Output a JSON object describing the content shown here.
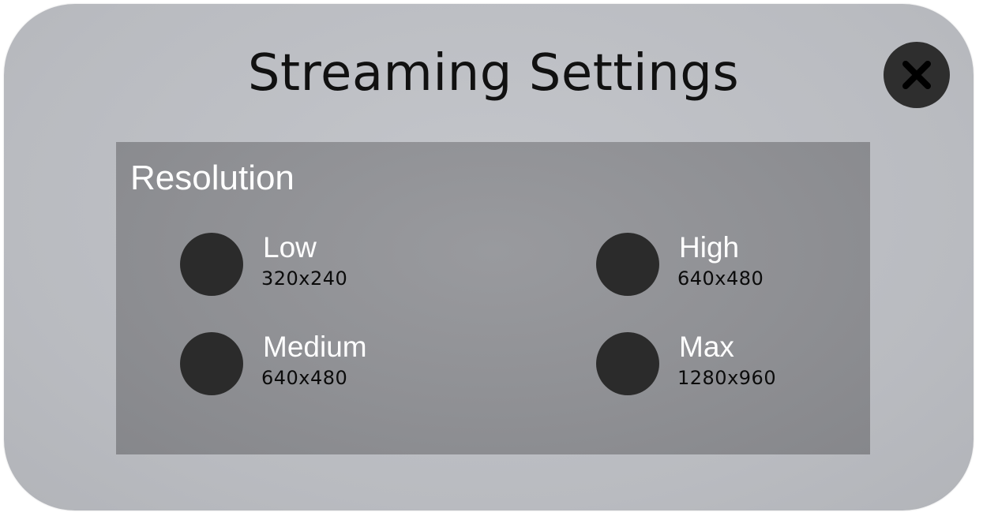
{
  "dialog": {
    "title": "Streaming Settings",
    "close_icon": "close-x-icon"
  },
  "resolution": {
    "label": "Resolution",
    "options": [
      {
        "name": "Low",
        "value": "320x240"
      },
      {
        "name": "Medium",
        "value": "640x480"
      },
      {
        "name": "High",
        "value": "640x480"
      },
      {
        "name": "Max",
        "value": "1280x960"
      }
    ]
  },
  "colors": {
    "dialog_bg": "#bfc1c6",
    "panel_bg": "#919296",
    "radio_fill": "#2b2b2b",
    "close_bg": "#2e2e2e",
    "title_text": "#111111",
    "option_text": "#ffffff"
  }
}
